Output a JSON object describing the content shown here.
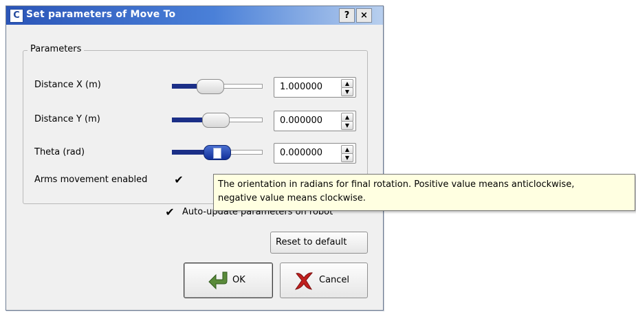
{
  "window": {
    "title": "Set parameters of Move To",
    "app_icon_letter": "C",
    "help_label": "?",
    "close_label": "×"
  },
  "parameters": {
    "group_label": "Parameters",
    "rows": [
      {
        "label": "Distance X (m)",
        "value": "1.000000",
        "slider_level": 0.55
      },
      {
        "label": "Distance Y (m)",
        "value": "0.000000",
        "slider_level": 0.5
      },
      {
        "label": "Theta (rad)",
        "value": "0.000000",
        "slider_level": 0.5
      }
    ],
    "arms_label": "Arms movement enabled",
    "arms_checked": true
  },
  "auto_update": {
    "label": "Auto-update parameters on robot",
    "checked": true
  },
  "buttons": {
    "reset": "Reset to default",
    "ok": "OK",
    "cancel": "Cancel"
  },
  "tooltip": {
    "line1": "The orientation in radians for final rotation. Positive value means anticlockwise,",
    "line2": "negative value means clockwise."
  },
  "glyphs": {
    "check": "✔",
    "spin_up": "▲",
    "spin_down": "▼"
  },
  "icons": {
    "ok": "ok-arrow-icon",
    "cancel": "cancel-x-icon"
  },
  "colors": {
    "title_bar": "#2b55b8",
    "slider_fill": "#1b2f87",
    "tooltip_bg": "#ffffe1",
    "ok_icon": "#5a8a3a",
    "cancel_icon": "#c0201e"
  }
}
